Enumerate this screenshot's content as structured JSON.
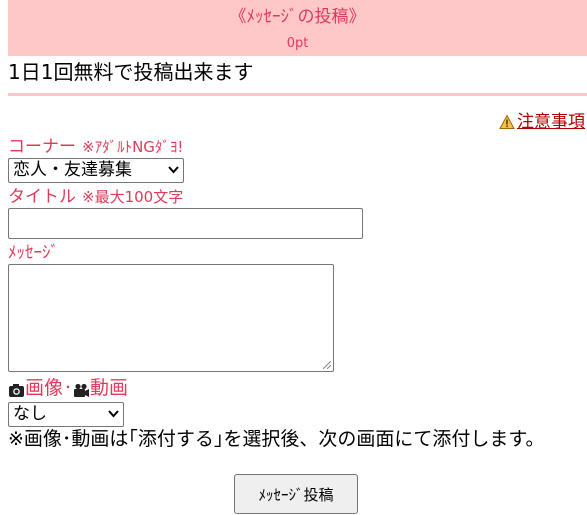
{
  "header": {
    "title": "《ﾒｯｾｰｼﾞの投稿》",
    "points": "0pt"
  },
  "intro": "1日1回無料で投稿出来ます",
  "notice": {
    "icon": "warning-icon",
    "label": "注意事項"
  },
  "corner": {
    "label": "コーナー",
    "note": "※ｱﾀﾞﾙﾄNGﾀﾞﾖ!",
    "selected": "恋人・友達募集"
  },
  "title_field": {
    "label": "タイトル",
    "note": "※最大100文字",
    "value": ""
  },
  "message_field": {
    "label": "ﾒｯｾｰｼﾞ",
    "value": ""
  },
  "media": {
    "image_icon": "camera-icon",
    "image_label": "画像",
    "separator": "･",
    "video_icon": "video-camera-icon",
    "video_label": "動画",
    "selected": "なし",
    "note": "※画像･動画は｢添付する｣を選択後、次の画面にて添付します。"
  },
  "submit_label": "ﾒｯｾｰｼﾞ投稿",
  "colors": {
    "accent": "#e03a5a",
    "header_bg": "#ffc8c8",
    "link": "#b00000"
  }
}
